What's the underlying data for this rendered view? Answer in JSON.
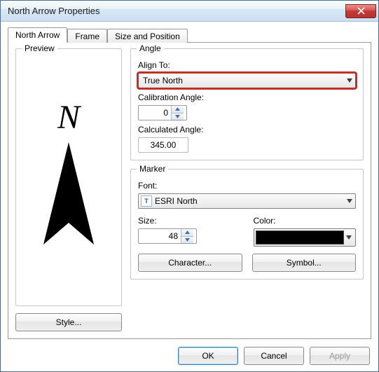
{
  "window": {
    "title": "North Arrow Properties"
  },
  "tabs": [
    "North Arrow",
    "Frame",
    "Size and Position"
  ],
  "preview": {
    "group_label": "Preview",
    "style_btn": "Style..."
  },
  "angle": {
    "group_label": "Angle",
    "align_to_label": "Align To:",
    "align_to_value": "True North",
    "calib_label": "Calibration Angle:",
    "calib_value": "0",
    "calc_label": "Calculated Angle:",
    "calc_value": "345.00"
  },
  "marker": {
    "group_label": "Marker",
    "font_label": "Font:",
    "font_value": "ESRI North",
    "size_label": "Size:",
    "size_value": "48",
    "color_label": "Color:",
    "color_value": "#000000",
    "character_btn": "Character...",
    "symbol_btn": "Symbol..."
  },
  "buttons": {
    "ok": "OK",
    "cancel": "Cancel",
    "apply": "Apply"
  }
}
